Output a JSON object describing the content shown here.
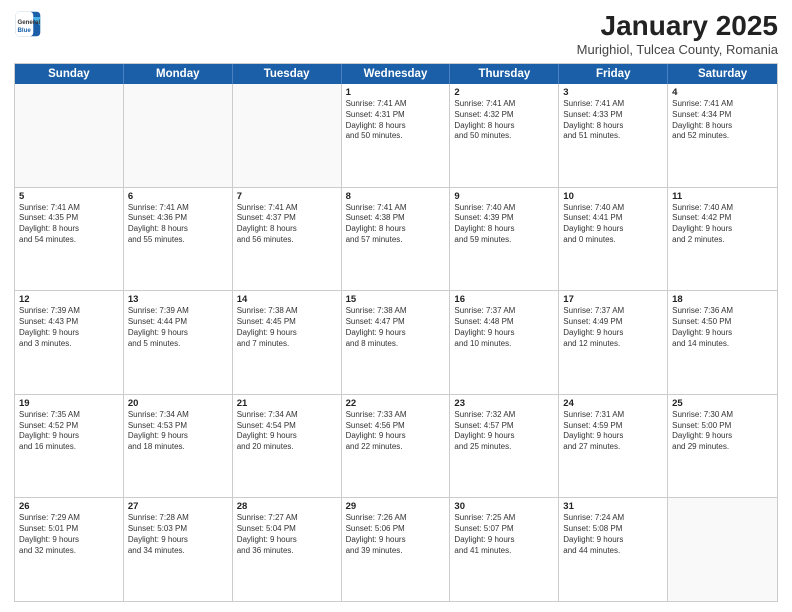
{
  "header": {
    "logo_general": "General",
    "logo_blue": "Blue",
    "title": "January 2025",
    "location": "Murighiol, Tulcea County, Romania"
  },
  "weekdays": [
    "Sunday",
    "Monday",
    "Tuesday",
    "Wednesday",
    "Thursday",
    "Friday",
    "Saturday"
  ],
  "rows": [
    [
      {
        "day": "",
        "text": ""
      },
      {
        "day": "",
        "text": ""
      },
      {
        "day": "",
        "text": ""
      },
      {
        "day": "1",
        "text": "Sunrise: 7:41 AM\nSunset: 4:31 PM\nDaylight: 8 hours\nand 50 minutes."
      },
      {
        "day": "2",
        "text": "Sunrise: 7:41 AM\nSunset: 4:32 PM\nDaylight: 8 hours\nand 50 minutes."
      },
      {
        "day": "3",
        "text": "Sunrise: 7:41 AM\nSunset: 4:33 PM\nDaylight: 8 hours\nand 51 minutes."
      },
      {
        "day": "4",
        "text": "Sunrise: 7:41 AM\nSunset: 4:34 PM\nDaylight: 8 hours\nand 52 minutes."
      }
    ],
    [
      {
        "day": "5",
        "text": "Sunrise: 7:41 AM\nSunset: 4:35 PM\nDaylight: 8 hours\nand 54 minutes."
      },
      {
        "day": "6",
        "text": "Sunrise: 7:41 AM\nSunset: 4:36 PM\nDaylight: 8 hours\nand 55 minutes."
      },
      {
        "day": "7",
        "text": "Sunrise: 7:41 AM\nSunset: 4:37 PM\nDaylight: 8 hours\nand 56 minutes."
      },
      {
        "day": "8",
        "text": "Sunrise: 7:41 AM\nSunset: 4:38 PM\nDaylight: 8 hours\nand 57 minutes."
      },
      {
        "day": "9",
        "text": "Sunrise: 7:40 AM\nSunset: 4:39 PM\nDaylight: 8 hours\nand 59 minutes."
      },
      {
        "day": "10",
        "text": "Sunrise: 7:40 AM\nSunset: 4:41 PM\nDaylight: 9 hours\nand 0 minutes."
      },
      {
        "day": "11",
        "text": "Sunrise: 7:40 AM\nSunset: 4:42 PM\nDaylight: 9 hours\nand 2 minutes."
      }
    ],
    [
      {
        "day": "12",
        "text": "Sunrise: 7:39 AM\nSunset: 4:43 PM\nDaylight: 9 hours\nand 3 minutes."
      },
      {
        "day": "13",
        "text": "Sunrise: 7:39 AM\nSunset: 4:44 PM\nDaylight: 9 hours\nand 5 minutes."
      },
      {
        "day": "14",
        "text": "Sunrise: 7:38 AM\nSunset: 4:45 PM\nDaylight: 9 hours\nand 7 minutes."
      },
      {
        "day": "15",
        "text": "Sunrise: 7:38 AM\nSunset: 4:47 PM\nDaylight: 9 hours\nand 8 minutes."
      },
      {
        "day": "16",
        "text": "Sunrise: 7:37 AM\nSunset: 4:48 PM\nDaylight: 9 hours\nand 10 minutes."
      },
      {
        "day": "17",
        "text": "Sunrise: 7:37 AM\nSunset: 4:49 PM\nDaylight: 9 hours\nand 12 minutes."
      },
      {
        "day": "18",
        "text": "Sunrise: 7:36 AM\nSunset: 4:50 PM\nDaylight: 9 hours\nand 14 minutes."
      }
    ],
    [
      {
        "day": "19",
        "text": "Sunrise: 7:35 AM\nSunset: 4:52 PM\nDaylight: 9 hours\nand 16 minutes."
      },
      {
        "day": "20",
        "text": "Sunrise: 7:34 AM\nSunset: 4:53 PM\nDaylight: 9 hours\nand 18 minutes."
      },
      {
        "day": "21",
        "text": "Sunrise: 7:34 AM\nSunset: 4:54 PM\nDaylight: 9 hours\nand 20 minutes."
      },
      {
        "day": "22",
        "text": "Sunrise: 7:33 AM\nSunset: 4:56 PM\nDaylight: 9 hours\nand 22 minutes."
      },
      {
        "day": "23",
        "text": "Sunrise: 7:32 AM\nSunset: 4:57 PM\nDaylight: 9 hours\nand 25 minutes."
      },
      {
        "day": "24",
        "text": "Sunrise: 7:31 AM\nSunset: 4:59 PM\nDaylight: 9 hours\nand 27 minutes."
      },
      {
        "day": "25",
        "text": "Sunrise: 7:30 AM\nSunset: 5:00 PM\nDaylight: 9 hours\nand 29 minutes."
      }
    ],
    [
      {
        "day": "26",
        "text": "Sunrise: 7:29 AM\nSunset: 5:01 PM\nDaylight: 9 hours\nand 32 minutes."
      },
      {
        "day": "27",
        "text": "Sunrise: 7:28 AM\nSunset: 5:03 PM\nDaylight: 9 hours\nand 34 minutes."
      },
      {
        "day": "28",
        "text": "Sunrise: 7:27 AM\nSunset: 5:04 PM\nDaylight: 9 hours\nand 36 minutes."
      },
      {
        "day": "29",
        "text": "Sunrise: 7:26 AM\nSunset: 5:06 PM\nDaylight: 9 hours\nand 39 minutes."
      },
      {
        "day": "30",
        "text": "Sunrise: 7:25 AM\nSunset: 5:07 PM\nDaylight: 9 hours\nand 41 minutes."
      },
      {
        "day": "31",
        "text": "Sunrise: 7:24 AM\nSunset: 5:08 PM\nDaylight: 9 hours\nand 44 minutes."
      },
      {
        "day": "",
        "text": ""
      }
    ]
  ]
}
